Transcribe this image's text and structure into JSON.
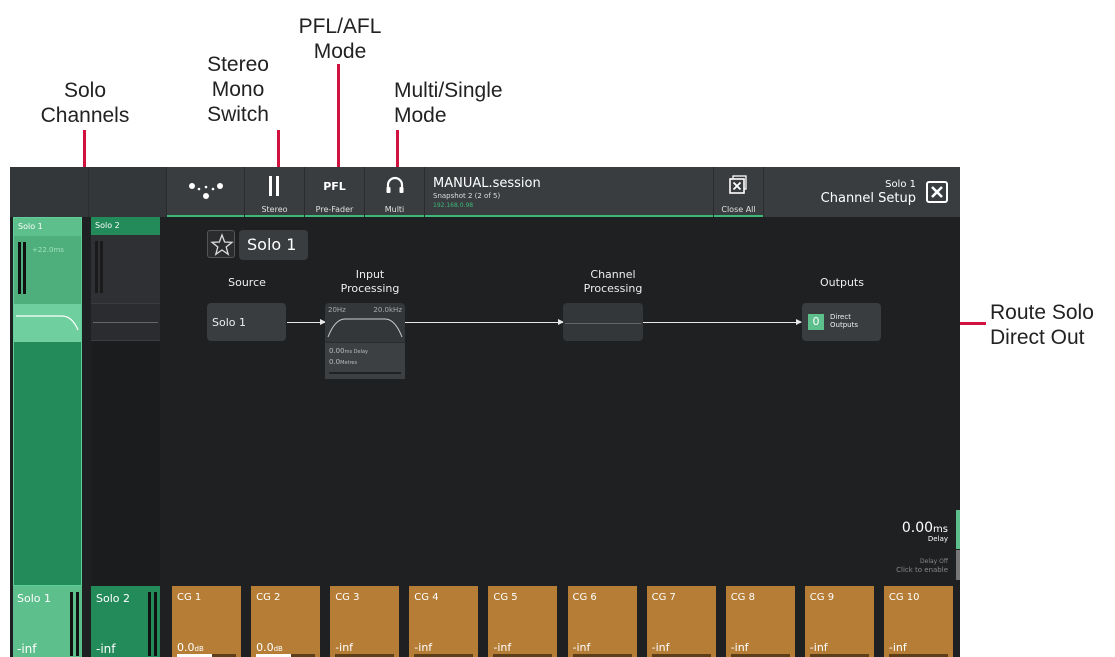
{
  "callouts": {
    "solo_channels": "Solo\nChannels",
    "stereo_mono": "Stereo\nMono\nSwitch",
    "pfl_afl": "PFL/AFL\nMode",
    "multi_single": "Multi/Single\nMode",
    "route_solo": "Route Solo\nDirect Out"
  },
  "toolbar": {
    "stereo_label": "Stereo",
    "pfl_text": "PFL",
    "pfl_label": "Pre-Fader",
    "multi_label": "Multi",
    "session_title": "MANUAL.session",
    "session_snapshot": "Snapshot 2 (2 of 5)",
    "session_ip": "192.168.0.98",
    "close_all_label": "Close All",
    "channel_name": "Solo 1",
    "channel_setup": "Channel Setup"
  },
  "strips": {
    "solo1_label": "Solo 1",
    "solo1_delay": "+22.0ms",
    "solo2_label": "Solo 2"
  },
  "main": {
    "channel_title": "Solo 1",
    "source_heading": "Source",
    "source_value": "Solo 1",
    "input_heading": "Input\nProcessing",
    "hpf": "20Hz",
    "lpf": "20.0kHz",
    "delay_value": "0.00",
    "delay_unit": "ms Delay",
    "metres_value": "0.0",
    "metres_unit": "Metres",
    "channel_proc_heading": "Channel\nProcessing",
    "outputs_heading": "Outputs",
    "direct_count": "0",
    "direct_label": "Direct\nOutputs",
    "delay_big": "0.00",
    "delay_big_unit": "ms",
    "delay_caption": "Delay",
    "delay_off": "Delay Off",
    "click_enable": "Click to enable"
  },
  "bottom": {
    "solo1": {
      "name": "Solo 1",
      "value": "-inf"
    },
    "solo2": {
      "name": "Solo 2",
      "value": "-inf"
    },
    "cgs": [
      {
        "name": "CG 1",
        "value": "0.0",
        "unit": "dB",
        "level": 0.6
      },
      {
        "name": "CG 2",
        "value": "0.0",
        "unit": "dB",
        "level": 0.6
      },
      {
        "name": "CG 3",
        "value": "-inf",
        "unit": "",
        "level": 0
      },
      {
        "name": "CG 4",
        "value": "-inf",
        "unit": "",
        "level": 0
      },
      {
        "name": "CG 5",
        "value": "-inf",
        "unit": "",
        "level": 0
      },
      {
        "name": "CG 6",
        "value": "-inf",
        "unit": "",
        "level": 0
      },
      {
        "name": "CG 7",
        "value": "-inf",
        "unit": "",
        "level": 0
      },
      {
        "name": "CG 8",
        "value": "-inf",
        "unit": "",
        "level": 0
      },
      {
        "name": "CG 9",
        "value": "-inf",
        "unit": "",
        "level": 0
      },
      {
        "name": "CG 10",
        "value": "-inf",
        "unit": "",
        "level": 0
      }
    ]
  },
  "colors": {
    "accent_green": "#3cb878",
    "cg_orange": "#b57d35",
    "callout_red": "#d1123f"
  }
}
